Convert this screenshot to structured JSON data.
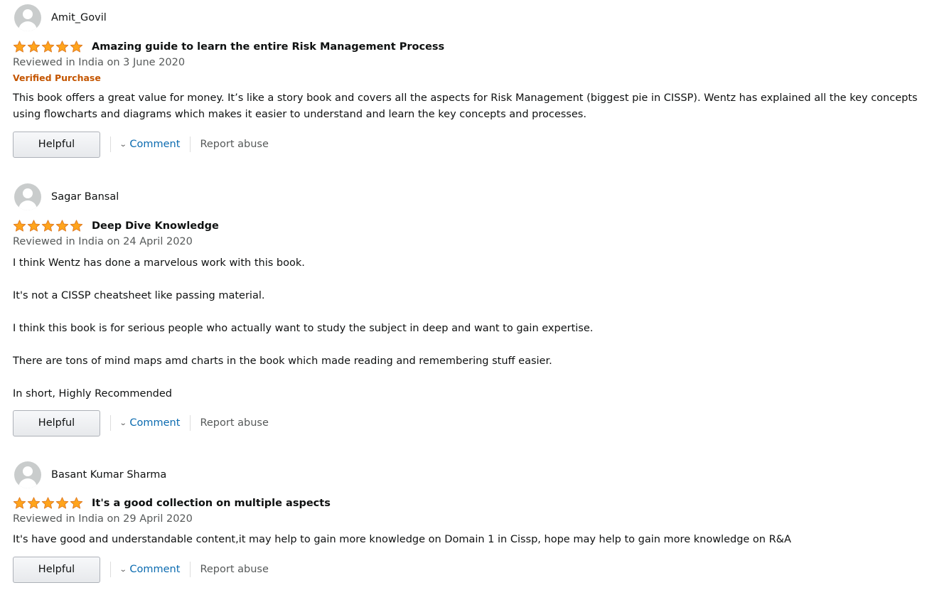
{
  "colors": {
    "star": "#ffa41c",
    "link": "#0b6bb0",
    "verified": "#c45500",
    "secondary_text": "#565959"
  },
  "icons": {
    "avatar": "default-user-avatar-icon",
    "star": "star-icon",
    "chevron": "chevron-down-icon"
  },
  "reviews": [
    {
      "author": "Amit_Govil",
      "rating": 5,
      "title": "Amazing guide to learn the entire Risk Management Process",
      "date": "Reviewed in India on 3 June 2020",
      "badge": "Verified Purchase",
      "body": [
        "This book offers a great value for money. It’s like a story book and covers all the aspects for Risk Management (biggest pie in CISSP). Wentz has explained all the key concepts using flowcharts and diagrams which makes it easier to understand and learn the key concepts and processes."
      ],
      "helpful_label": "Helpful",
      "comment_label": "Comment",
      "report_label": "Report abuse"
    },
    {
      "author": "Sagar Bansal",
      "rating": 5,
      "title": "Deep Dive Knowledge",
      "date": "Reviewed in India on 24 April 2020",
      "body": [
        "I think Wentz has done a marvelous work with this book.",
        "It's not a CISSP cheatsheet like passing material.",
        "I think this book is for serious people who actually want to study the subject in deep and want to gain expertise.",
        "There are tons of mind maps amd charts in the book which made reading and remembering stuff easier.",
        "In short, Highly Recommended"
      ],
      "helpful_label": "Helpful",
      "comment_label": "Comment",
      "report_label": "Report abuse"
    },
    {
      "author": "Basant Kumar Sharma",
      "rating": 5,
      "title": "It's a good collection on multiple aspects",
      "date": "Reviewed in India on 29 April 2020",
      "body": [
        "It's have good and understandable content,it may help to gain more knowledge on Domain 1 in Cissp, hope may help to gain more knowledge on R&A"
      ],
      "helpful_label": "Helpful",
      "comment_label": "Comment",
      "report_label": "Report abuse"
    }
  ]
}
